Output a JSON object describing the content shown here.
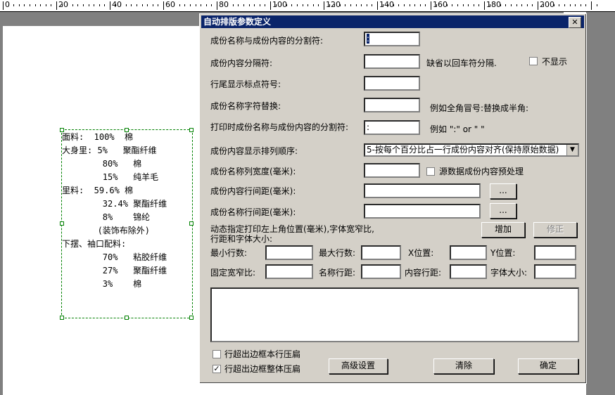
{
  "ruler": {
    "labels": [
      "0",
      "20",
      "40",
      "60",
      "80",
      "100",
      "120",
      "140",
      "160",
      "180",
      "200"
    ]
  },
  "label_preview": {
    "lines": [
      "面料:  100%  棉",
      "大身里: 5%   聚酯纤维",
      "        80%   棉",
      "        15%   纯羊毛",
      "里料:  59.6% 棉",
      "        32.4% 聚酯纤维",
      "        8%    锦纶",
      "       (装饰布除外)",
      "下摆、袖口配料:",
      "        70%   粘胶纤维",
      "        27%   聚酯纤维",
      "        3%    棉"
    ]
  },
  "dialog": {
    "title": "自动排版参数定义",
    "close": "✕",
    "rows": {
      "sep_label": "成份名称与成份内容的分割符:",
      "sep_value": ":",
      "content_sep_label": "成份内容分隔符:",
      "content_sep_value": "",
      "content_sep_hint": "缺省以回车符分隔.",
      "hide_label": "不显示",
      "end_punct_label": "行尾显示标点符号:",
      "end_punct_value": "",
      "replace_label": "成份名称字符替换:",
      "replace_value": "",
      "replace_hint": "例如全角冒号:替换成半角:",
      "print_sep_label": "打印时成份名称与成份内容的分割符:",
      "print_sep_value": ":",
      "print_sep_hint": "例如  \":\" or \" \"",
      "order_label": "成份内容显示排列顺序:",
      "order_value": "5-按每个百分比占一行成份内容对齐(保持原始数据)",
      "col_width_label": "成份名称列宽度(毫米):",
      "col_width_value": "",
      "preprocess_label": "源数据成份内容预处理",
      "content_spacing_label": "成份内容行间距(毫米):",
      "content_spacing_value": "",
      "name_spacing_label": "成份名称行间距(毫米):",
      "name_spacing_value": "",
      "browse": "...",
      "dynamic_label": "动态指定打印左上角位置(毫米),字体宽窄比,\n行距和字体大小:",
      "add": "增加",
      "modify": "修正",
      "min_rows": "最小行数:",
      "max_rows": "最大行数:",
      "x_pos": "X位置:",
      "y_pos": "Y位置:",
      "fixed_ratio": "固定宽窄比:",
      "name_spacing": "名称行距:",
      "content_spacing": "内容行距:",
      "font_size": "字体大小:",
      "compress_row": "行超出边框本行压扁",
      "compress_all": "行超出边框整体压扁",
      "compress_row_checked": false,
      "compress_all_checked": true,
      "advanced": "高级设置",
      "clear": "清除",
      "ok": "确定"
    }
  }
}
